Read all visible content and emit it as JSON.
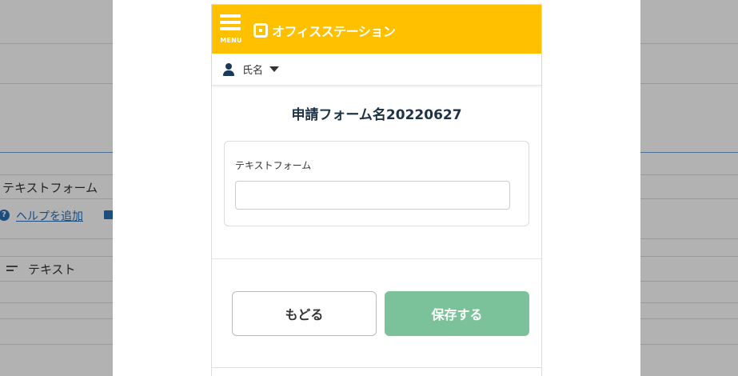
{
  "background": {
    "field_name": "テキストフォーム",
    "help_link": "ヘルプを追加",
    "field_type": "テキスト"
  },
  "app": {
    "menu_label": "MENU",
    "logo_text": "オフィスステーション",
    "brand_color": "#ffc000"
  },
  "user": {
    "name": "氏名"
  },
  "form": {
    "title": "申請フォーム名20220627",
    "field_label": "テキストフォーム",
    "field_value": "",
    "field_placeholder": ""
  },
  "actions": {
    "back_label": "もどる",
    "save_label": "保存する",
    "save_color": "#7bc29b"
  }
}
